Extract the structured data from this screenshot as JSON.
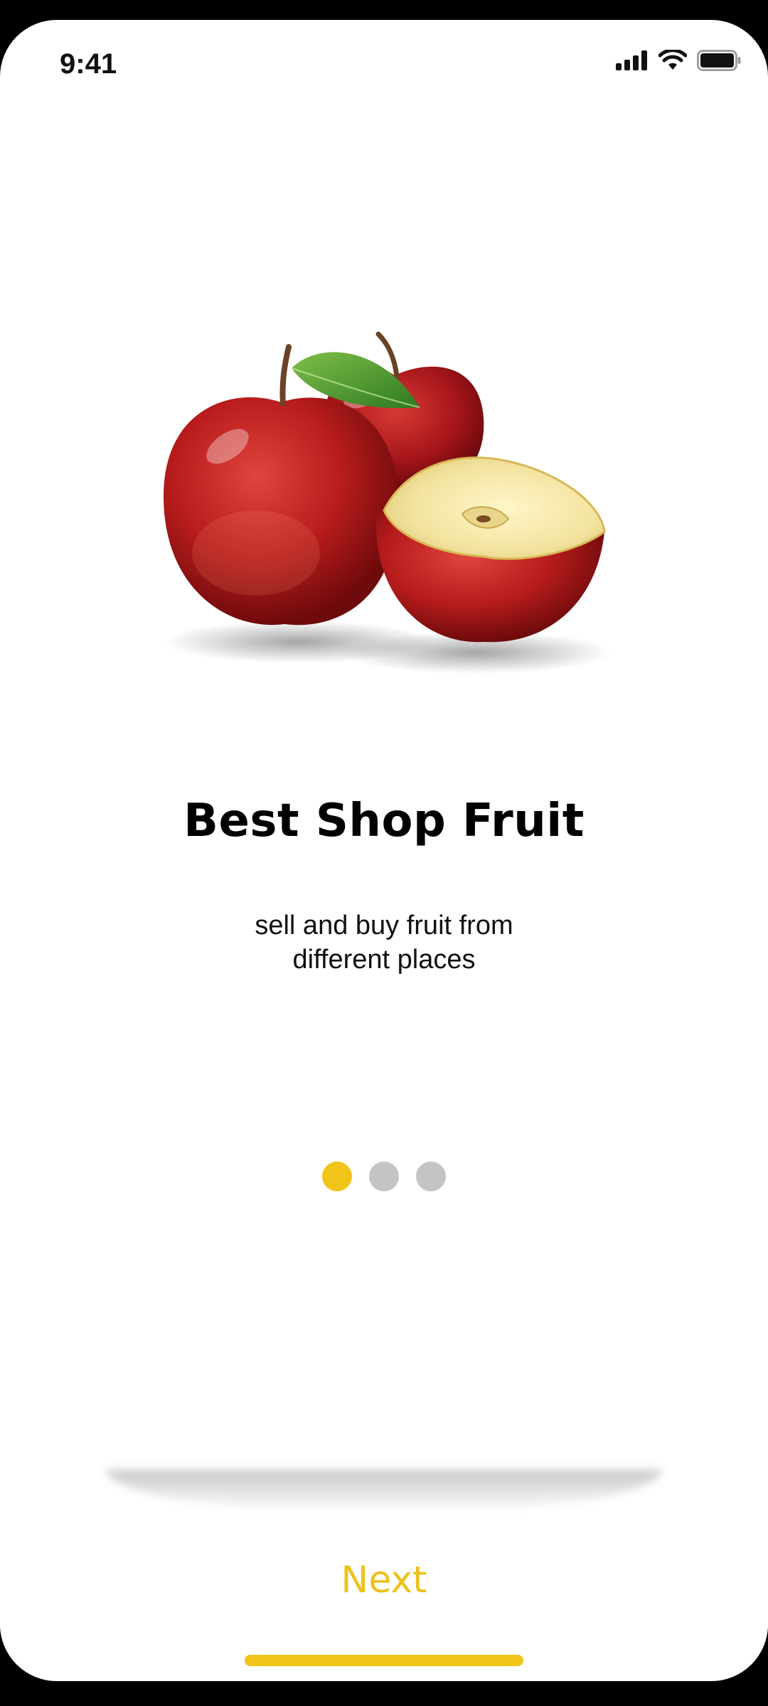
{
  "status_bar": {
    "time": "9:41",
    "icons": [
      "cellular-signal-icon",
      "wifi-icon",
      "battery-icon"
    ]
  },
  "hero": {
    "image": "apples-image"
  },
  "onboarding": {
    "title": "Best Shop Fruit",
    "subtitle": "sell and buy fruit from different places",
    "page_indicator": {
      "total": 3,
      "active_index": 0
    }
  },
  "footer": {
    "next_label": "Next"
  },
  "colors": {
    "accent": "#F1C419",
    "dot_inactive": "#C4C4C4",
    "next_text": "#ECC21D"
  }
}
